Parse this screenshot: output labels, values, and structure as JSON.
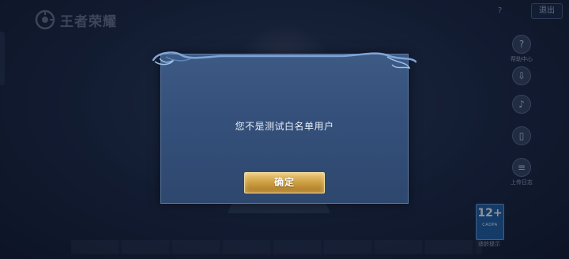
{
  "header": {
    "logo_text": "王者荣耀",
    "help_label": "?",
    "logout_label": "退出"
  },
  "side_tools": [
    {
      "icon": "help-icon",
      "label": "帮助中心"
    },
    {
      "icon": "download-icon",
      "label": ""
    },
    {
      "icon": "volume-icon",
      "label": ""
    },
    {
      "icon": "phone-icon",
      "label": ""
    },
    {
      "icon": "log-upload-icon",
      "label": "上传日志"
    }
  ],
  "age_rating": {
    "number": "12+",
    "sub": "CADPA",
    "label": "适龄提示"
  },
  "dialog": {
    "message": "您不是测试白名单用户",
    "confirm_label": "确定"
  },
  "colors": {
    "accent_gold": "#d4a64c",
    "dialog_blue": "#34507a",
    "badge_blue": "#1f63a8"
  }
}
